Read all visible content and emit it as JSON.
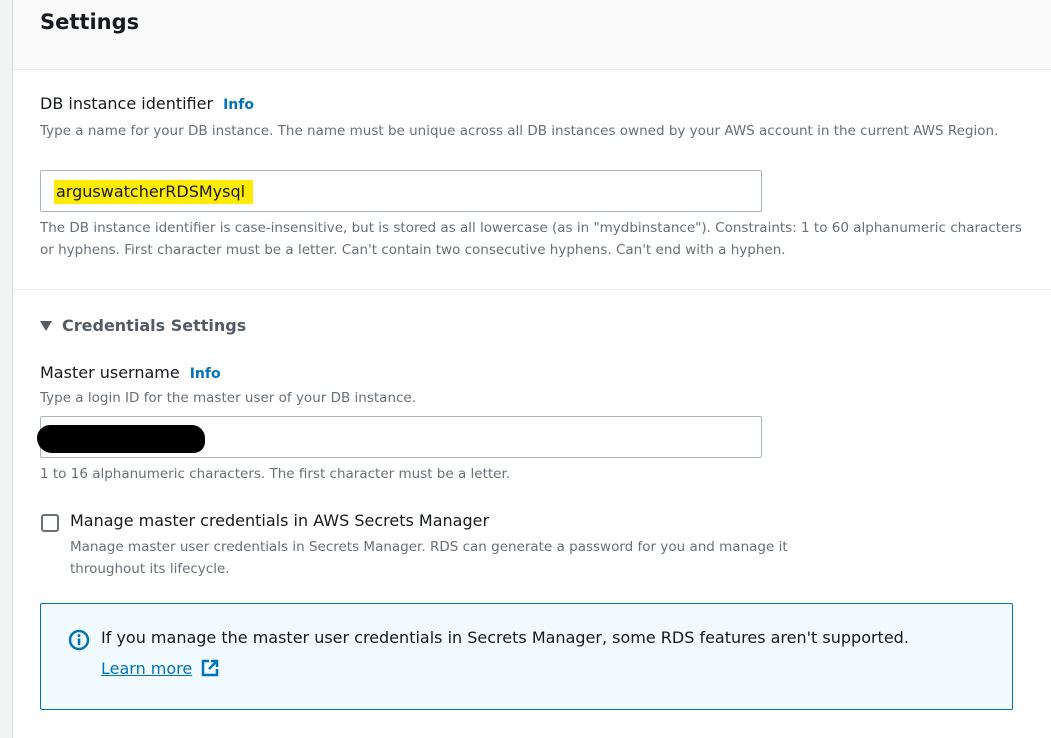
{
  "section": {
    "title": "Settings"
  },
  "db_identifier": {
    "label": "DB instance identifier",
    "info": "Info",
    "description": "Type a name for your DB instance. The name must be unique across all DB instances owned by your AWS account in the current AWS Region.",
    "value": "arguswatcherRDSMysql",
    "constraint": "The DB instance identifier is case-insensitive, but is stored as all lowercase (as in \"mydbinstance\"). Constraints: 1 to 60 alphanumeric characters or hyphens. First character must be a letter. Can't contain two consecutive hyphens. Can't end with a hyphen."
  },
  "credentials": {
    "title": "Credentials Settings",
    "username_label": "Master username",
    "info": "Info",
    "username_description": "Type a login ID for the master user of your DB instance.",
    "username_constraint": "1 to 16 alphanumeric characters. The first character must be a letter.",
    "manage_label": "Manage master credentials in AWS Secrets Manager",
    "manage_description": "Manage master user credentials in Secrets Manager. RDS can generate a password for you and manage it throughout its lifecycle.",
    "manage_checked": false
  },
  "alert": {
    "text": "If you manage the master user credentials in Secrets Manager, some RDS features aren't supported.",
    "link": "Learn more",
    "icon": "info-circle-icon",
    "color": "#0073bb"
  }
}
